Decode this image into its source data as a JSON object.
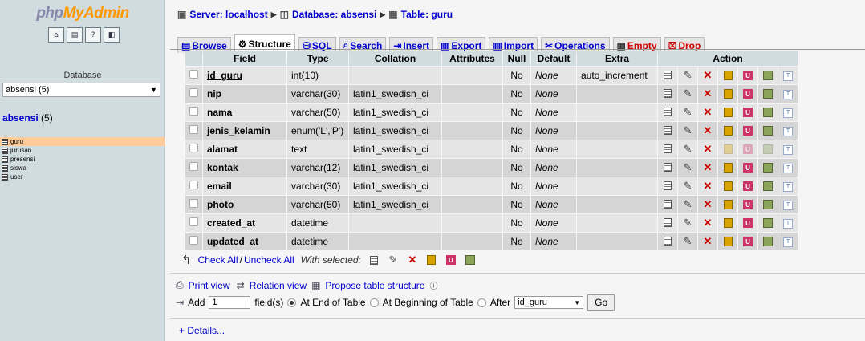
{
  "left": {
    "logo_php": "php",
    "logo_my": "My",
    "logo_admin": "Admin",
    "database_label": "Database",
    "database_select": "absensi (5)",
    "db_name": "absensi",
    "db_count": "(5)",
    "tables": [
      "guru",
      "jurusan",
      "presensi",
      "siswa",
      "user"
    ]
  },
  "breadcrumb": {
    "server": "Server: localhost",
    "database": "Database: absensi",
    "table": "Table: guru"
  },
  "tabs": [
    "Browse",
    "Structure",
    "SQL",
    "Search",
    "Insert",
    "Export",
    "Import",
    "Operations",
    "Empty",
    "Drop"
  ],
  "headers": [
    "Field",
    "Type",
    "Collation",
    "Attributes",
    "Null",
    "Default",
    "Extra",
    "Action"
  ],
  "rows": [
    {
      "field": "id_guru",
      "type": "int(10)",
      "collation": "",
      "attributes": "",
      "null": "No",
      "default": "None",
      "extra": "auto_increment"
    },
    {
      "field": "nip",
      "type": "varchar(30)",
      "collation": "latin1_swedish_ci",
      "attributes": "",
      "null": "No",
      "default": "None",
      "extra": ""
    },
    {
      "field": "nama",
      "type": "varchar(50)",
      "collation": "latin1_swedish_ci",
      "attributes": "",
      "null": "No",
      "default": "None",
      "extra": ""
    },
    {
      "field": "jenis_kelamin",
      "type": "enum('L','P')",
      "collation": "latin1_swedish_ci",
      "attributes": "",
      "null": "No",
      "default": "None",
      "extra": ""
    },
    {
      "field": "alamat",
      "type": "text",
      "collation": "latin1_swedish_ci",
      "attributes": "",
      "null": "No",
      "default": "None",
      "extra": ""
    },
    {
      "field": "kontak",
      "type": "varchar(12)",
      "collation": "latin1_swedish_ci",
      "attributes": "",
      "null": "No",
      "default": "None",
      "extra": ""
    },
    {
      "field": "email",
      "type": "varchar(30)",
      "collation": "latin1_swedish_ci",
      "attributes": "",
      "null": "No",
      "default": "None",
      "extra": ""
    },
    {
      "field": "photo",
      "type": "varchar(50)",
      "collation": "latin1_swedish_ci",
      "attributes": "",
      "null": "No",
      "default": "None",
      "extra": ""
    },
    {
      "field": "created_at",
      "type": "datetime",
      "collation": "",
      "attributes": "",
      "null": "No",
      "default": "None",
      "extra": ""
    },
    {
      "field": "updated_at",
      "type": "datetime",
      "collation": "",
      "attributes": "",
      "null": "No",
      "default": "None",
      "extra": ""
    }
  ],
  "footer": {
    "check_all": "Check All",
    "slash": "/",
    "uncheck_all": "Uncheck All",
    "with_selected": "With selected:",
    "print_view": "Print view",
    "relation_view": "Relation view",
    "propose": "Propose table structure",
    "add": "Add",
    "add_count": "1",
    "fields_label": "field(s)",
    "at_end": "At End of Table",
    "at_beginning": "At Beginning of Table",
    "after": "After",
    "after_select": "id_guru",
    "go": "Go",
    "details": "+ Details..."
  }
}
